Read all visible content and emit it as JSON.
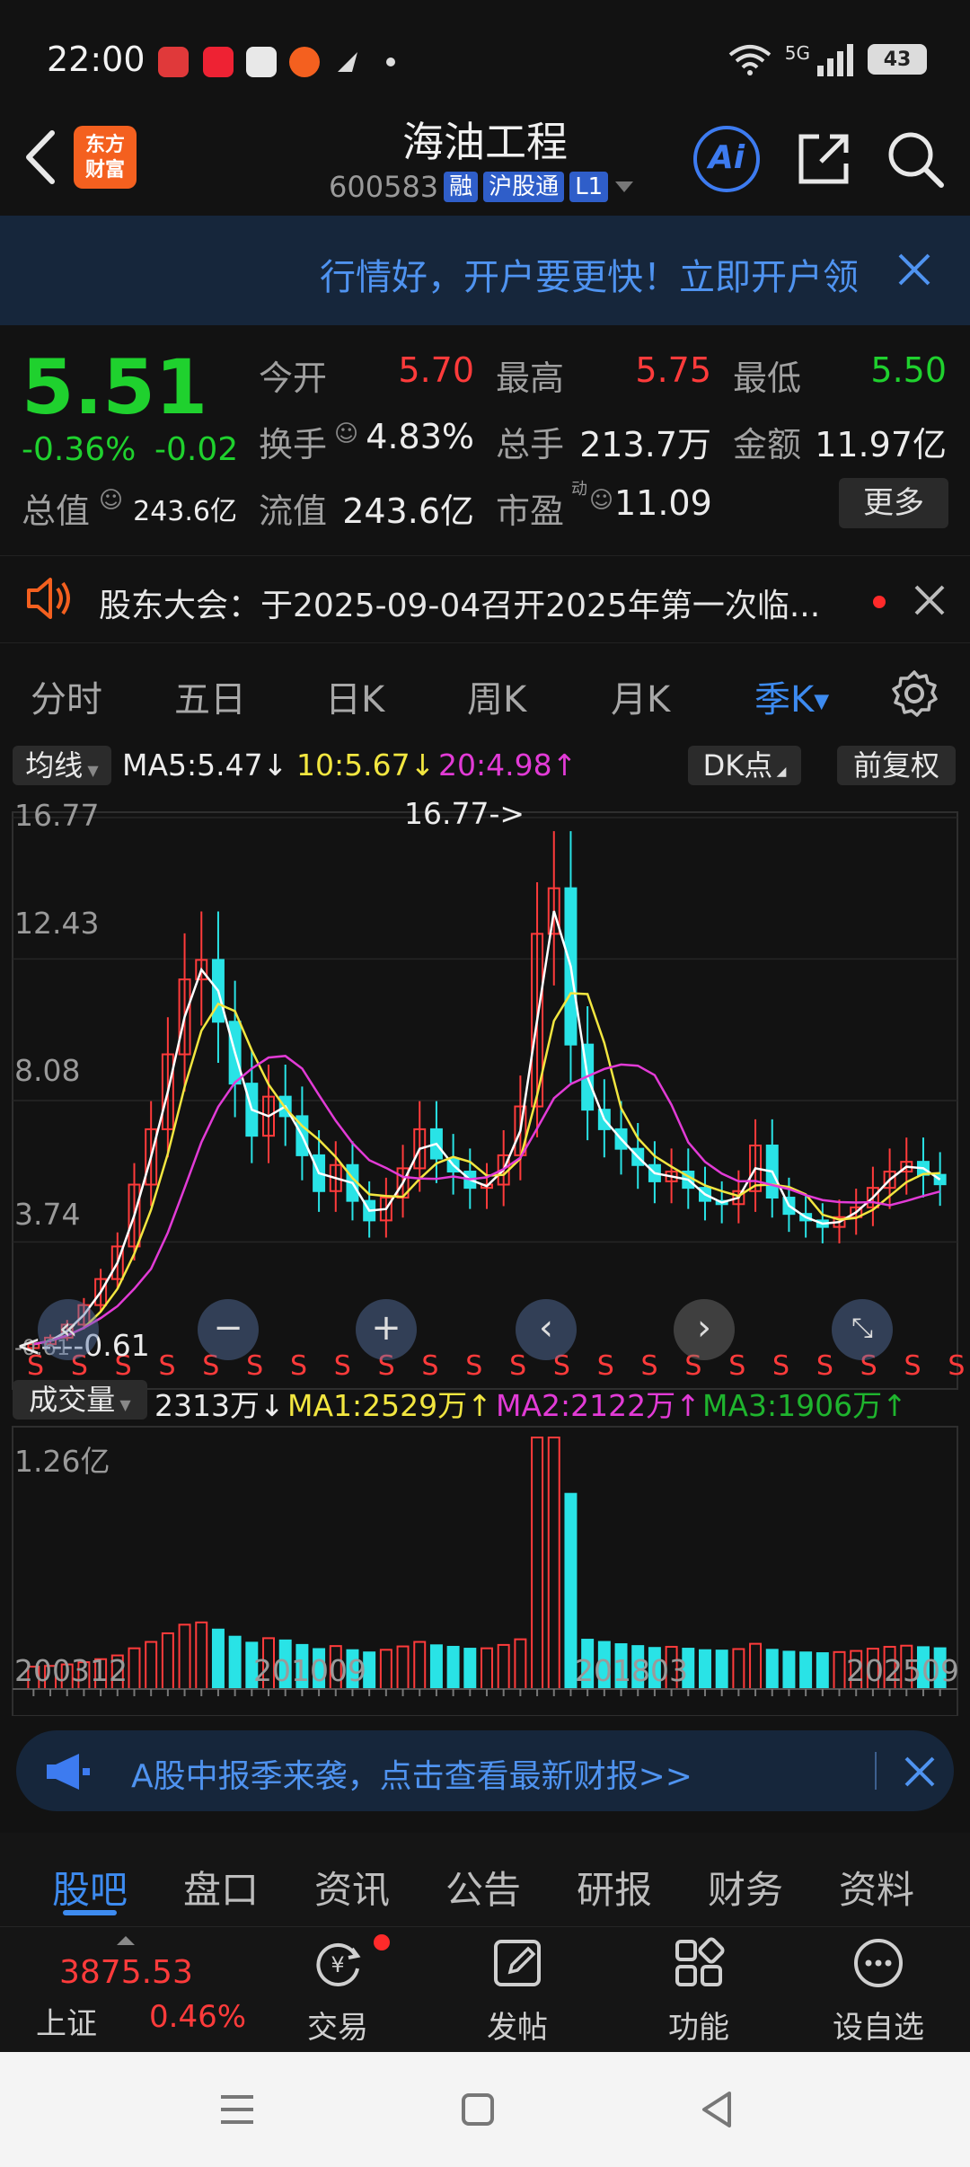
{
  "status_bar": {
    "time": "22:00",
    "network": "5G",
    "battery": "43"
  },
  "header": {
    "logo_line1": "东方",
    "logo_line2": "财富",
    "stock_name": "海油工程",
    "stock_code": "600583",
    "tag_margin": "融",
    "tag_connect": "沪股通",
    "tag_level": "L1",
    "ai_label": "Ai"
  },
  "banner": {
    "text": "行情好，开户要更快！立即开户领"
  },
  "quote": {
    "price": "5.51",
    "change_pct": "-0.36%",
    "change_val": "-0.02",
    "open_label": "今开",
    "open": "5.70",
    "high_label": "最高",
    "high": "5.75",
    "low_label": "最低",
    "low": "5.50",
    "turnover_label": "换手",
    "turnover": "4.83%",
    "volume_label": "总手",
    "volume": "213.7万",
    "amount_label": "金额",
    "amount": "11.97亿",
    "mktcap_label": "总值",
    "mktcap": "243.6亿",
    "float_label": "流值",
    "float": "243.6亿",
    "pe_label": "市盈",
    "pe_sup": "动",
    "pe": "11.09",
    "more": "更多"
  },
  "notice": {
    "text": "股东大会：于2025-09-04召开2025年第一次临..."
  },
  "period_tabs": [
    "分时",
    "五日",
    "日K",
    "周K",
    "月K",
    "季K"
  ],
  "active_period": 5,
  "chart": {
    "indicator_label": "均线",
    "ma5": "MA5:5.47↓",
    "ma10": "10:5.67↓",
    "ma20": "20:4.98↑",
    "dk_label": "DK点",
    "adjust_label": "前复权",
    "y_labels": [
      "16.77",
      "12.43",
      "8.08",
      "3.74",
      "-0.61"
    ],
    "max_marker": "16.77->",
    "min_marker": "<----0.61",
    "volume_label": "成交量",
    "vol_now": "2313万↓",
    "vol_ma1": "MA1:2529万↑",
    "vol_ma2": "MA2:2122万↑",
    "vol_ma3": "MA3:1906万↑",
    "vol_max": "1.26亿",
    "x_labels": [
      "200312",
      "201009",
      "201803",
      "202509"
    ],
    "s_marker": "S"
  },
  "chart_data": {
    "type": "candlestick",
    "period": "quarterly",
    "ylim": [
      -0.61,
      16.77
    ],
    "close_approx": [
      0.6,
      0.8,
      1.2,
      1.8,
      2.6,
      3.6,
      5.5,
      7.2,
      9.5,
      11.8,
      12.4,
      10.5,
      8.6,
      7.0,
      8.2,
      7.6,
      6.4,
      5.3,
      6.1,
      5.0,
      4.4,
      5.1,
      6.0,
      7.2,
      6.3,
      5.9,
      5.4,
      5.5,
      6.4,
      7.9,
      13.2,
      14.6,
      9.8,
      7.8,
      7.2,
      6.6,
      6.1,
      5.6,
      5.9,
      5.4,
      5.0,
      4.9,
      5.3,
      6.7,
      5.1,
      4.6,
      4.4,
      4.2,
      4.5,
      4.8,
      5.4,
      5.9,
      6.2,
      5.8,
      5.51
    ],
    "volume_max_label": "1.26亿",
    "volume_current": "2313万"
  },
  "report_banner": {
    "text": "A股中报季来袭，点击查看最新财报>>"
  },
  "info_tabs": [
    "股吧",
    "盘口",
    "资讯",
    "公告",
    "研报",
    "财务",
    "资料"
  ],
  "toolbar": {
    "index_value": "3875.53",
    "index_name": "上证",
    "index_change": "0.46%",
    "trade": "交易",
    "post": "发帖",
    "functions": "功能",
    "watchlist": "设自选"
  }
}
